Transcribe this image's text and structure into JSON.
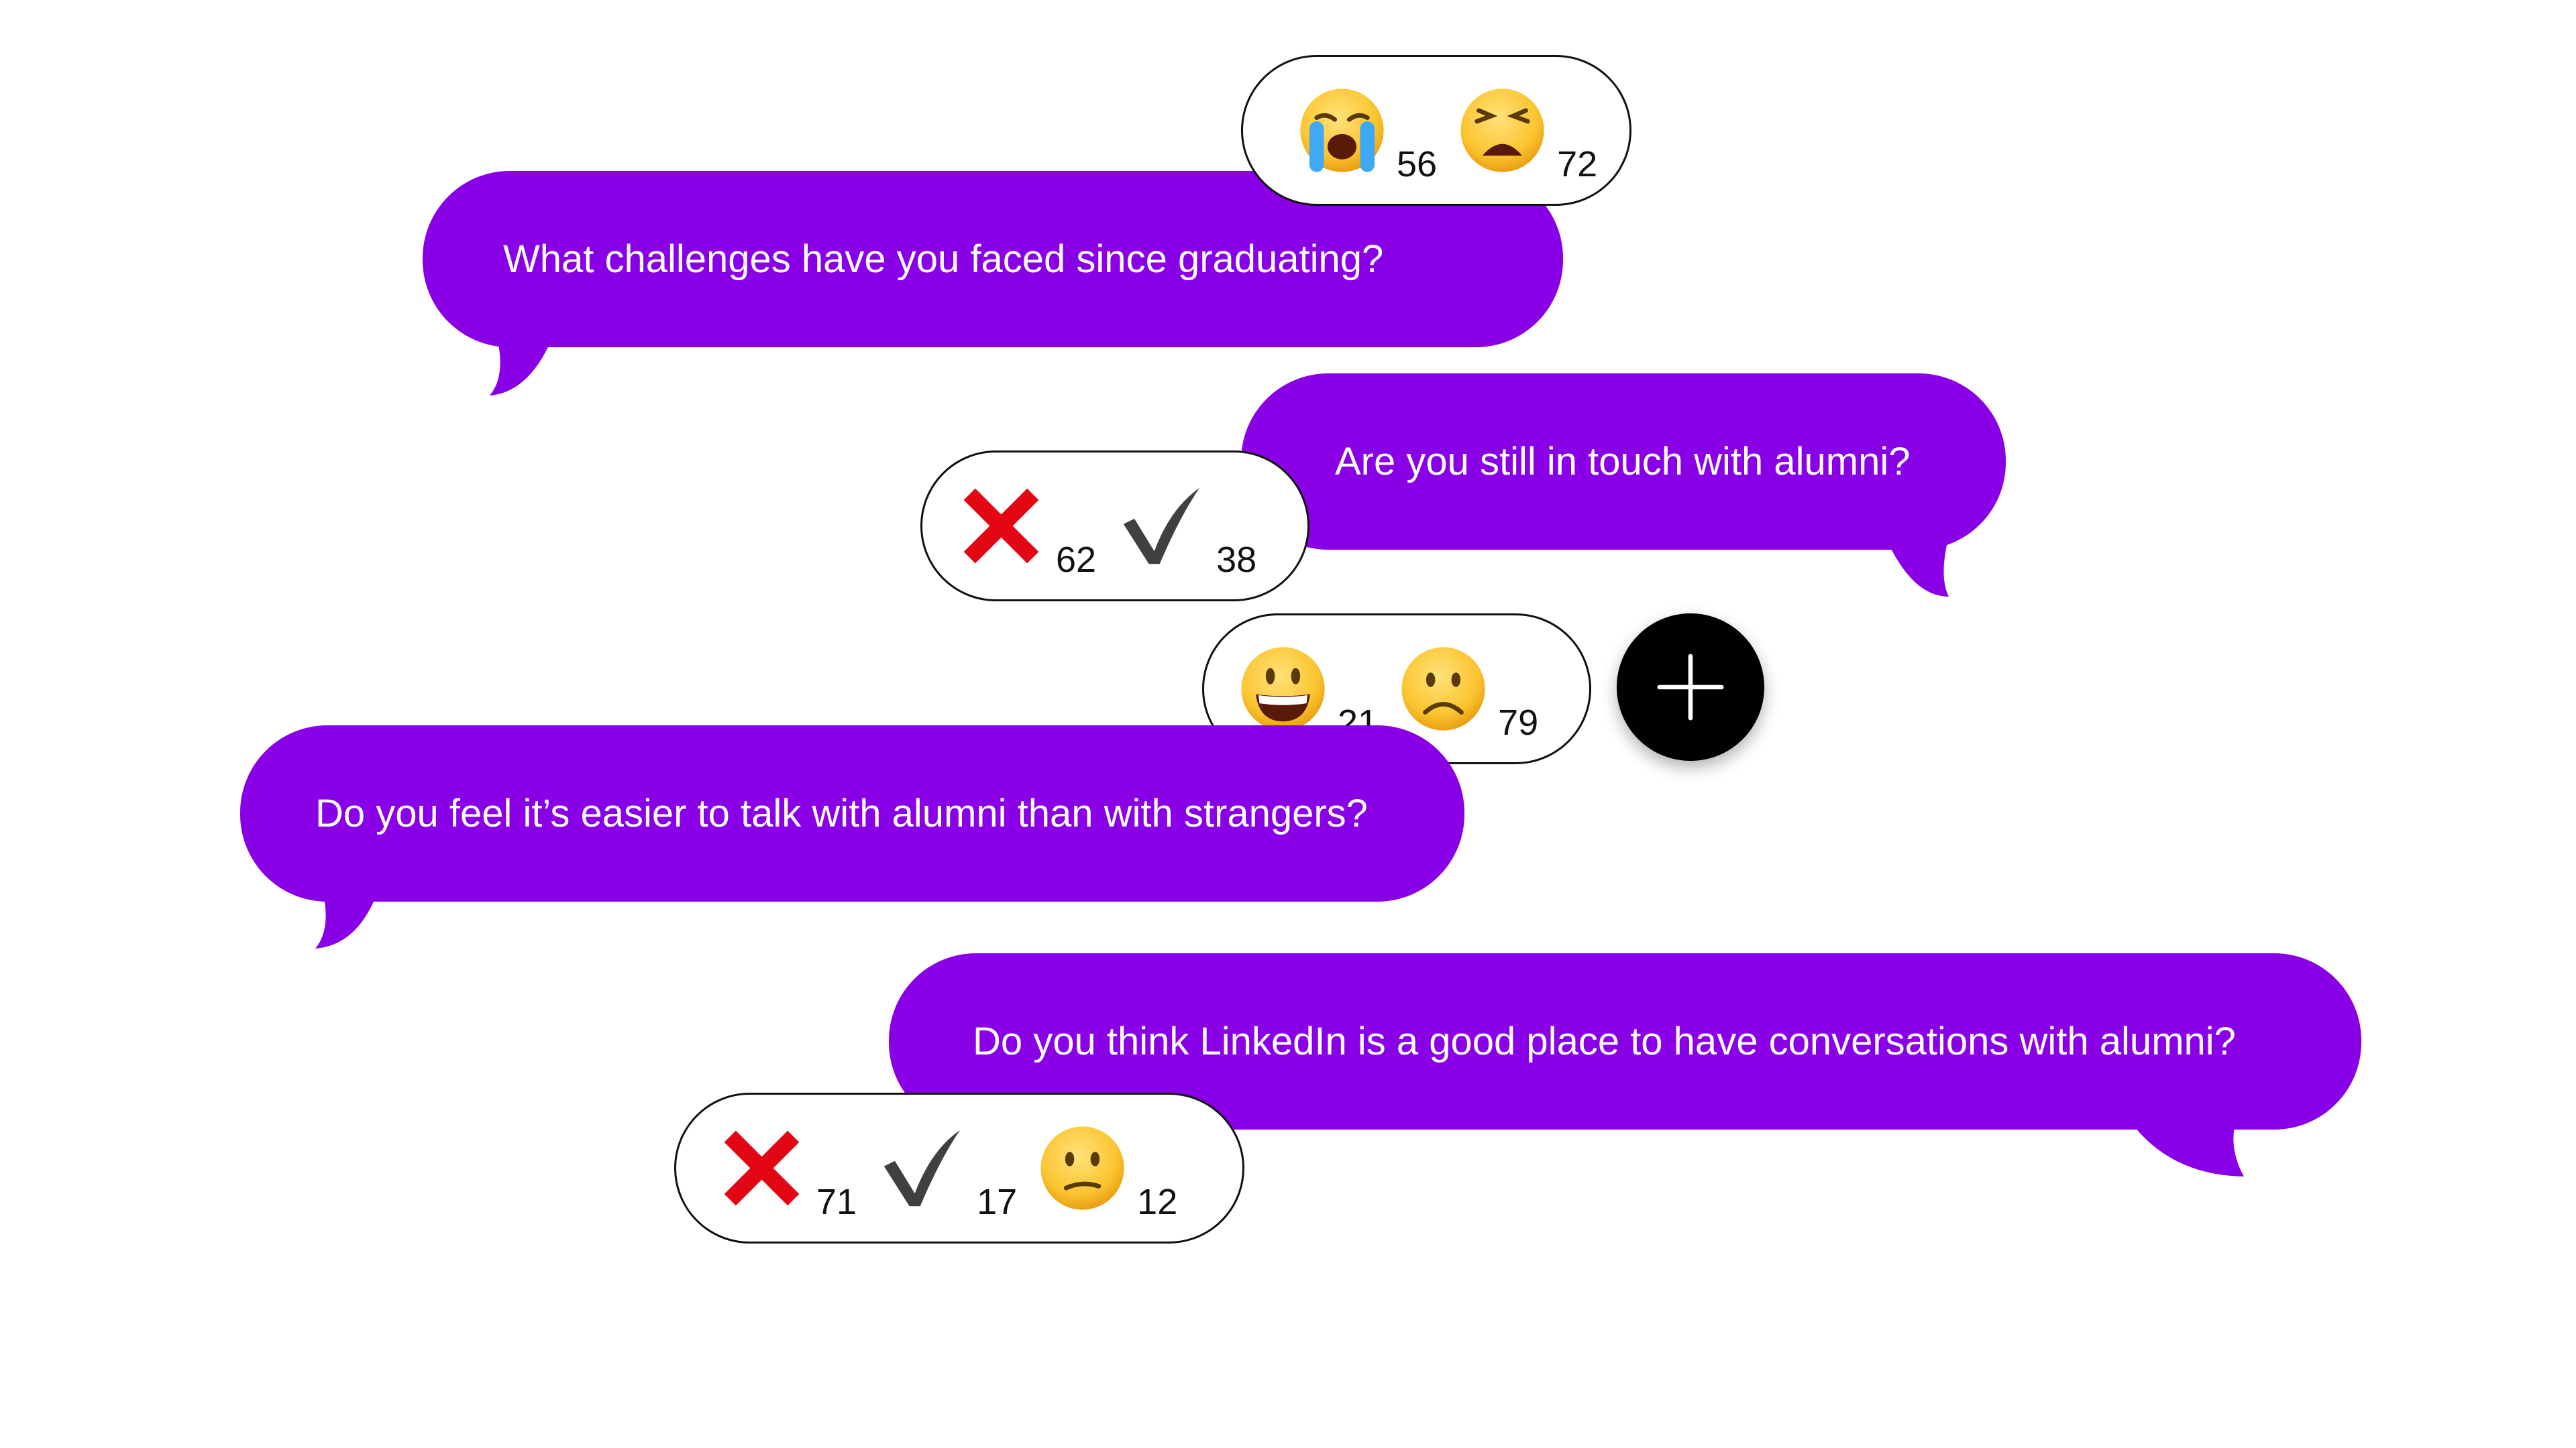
{
  "colors": {
    "bubble": "#8a00e6",
    "text": "#ffffff",
    "add_button": "#000000"
  },
  "messages": [
    {
      "text": "What challenges have you faced since graduating?"
    },
    {
      "text": "Are you still in touch with alumni?"
    },
    {
      "text": "Do you feel it’s easier to talk with alumni than with strangers?"
    },
    {
      "text": "Do you think LinkedIn is a good place to have conversations with alumni?"
    }
  ],
  "reactions": {
    "q1": [
      {
        "icon": "loudly-crying-face-icon",
        "count": "56"
      },
      {
        "icon": "weary-face-icon",
        "count": "72"
      }
    ],
    "q2": [
      {
        "icon": "cross-mark-icon",
        "count": "62"
      },
      {
        "icon": "check-mark-icon",
        "count": "38"
      }
    ],
    "q3": [
      {
        "icon": "grinning-face-icon",
        "count": "21"
      },
      {
        "icon": "frowning-face-icon",
        "count": "79"
      }
    ],
    "q4": [
      {
        "icon": "cross-mark-icon",
        "count": "71"
      },
      {
        "icon": "check-mark-icon",
        "count": "17"
      },
      {
        "icon": "confused-face-icon",
        "count": "12"
      }
    ]
  },
  "add_button": {
    "icon": "plus-icon"
  }
}
